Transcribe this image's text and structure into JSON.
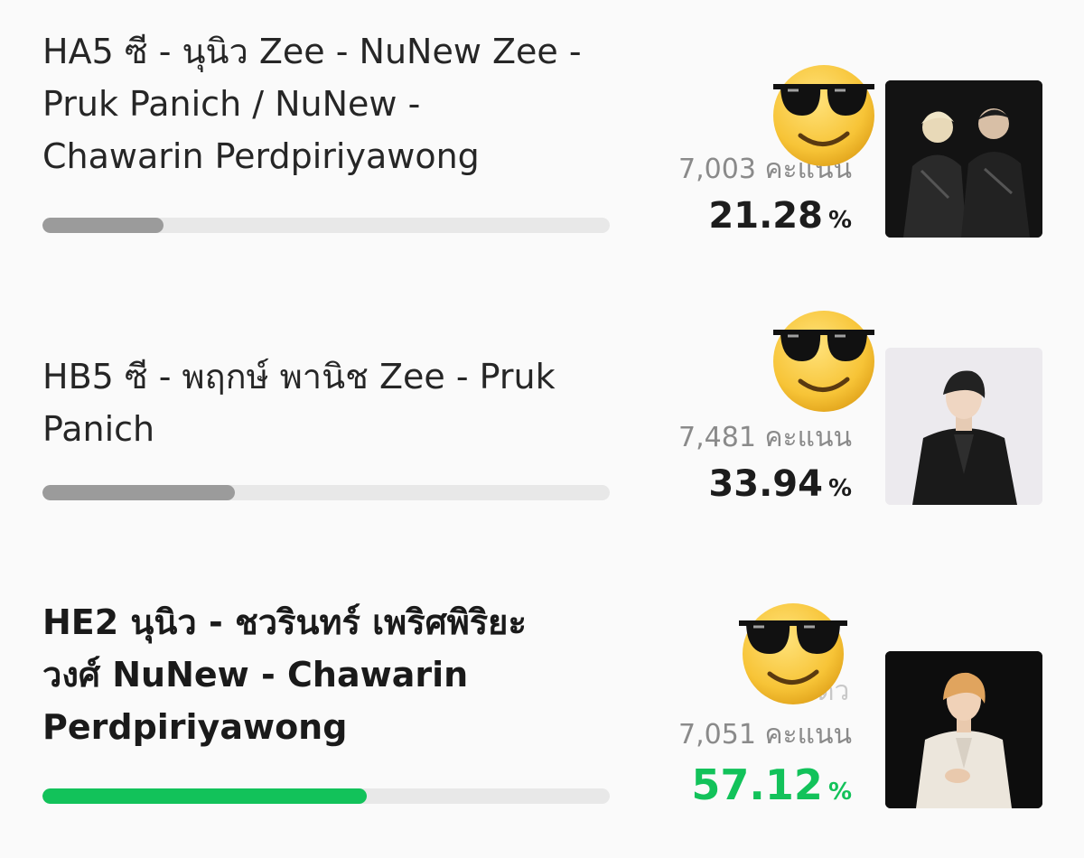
{
  "colors": {
    "leader": "#12c25a",
    "bar_default": "#9b9b9b",
    "track": "#e8e8e8"
  },
  "entries": [
    {
      "title": "HA5 ซี - นุนิว Zee - NuNew Zee - Pruk Panich / NuNew - Chawarin Perdpiriyawong",
      "title_lines": [
        "HA5 ซี - นุนิว Zee - NuNew Zee -",
        "Pruk Panich / NuNew -",
        "Chawarin Perdpiriyawong"
      ],
      "votes": "7,003 คะแนน",
      "percent": "21.28",
      "percent_sign": "%",
      "percent_value": 21.28,
      "emoji": "sunglasses-emoji",
      "photo": "duo-photo-icon",
      "leader": false
    },
    {
      "title": "HB5 ซี - พฤกษ์ พานิช Zee - Pruk Panich",
      "title_lines": [
        "HB5 ซี - พฤกษ์ พานิช Zee - Pruk",
        "Panich"
      ],
      "votes": "7,481 คะแนน",
      "percent": "33.94",
      "percent_sign": "%",
      "percent_value": 33.94,
      "emoji": "sunglasses-emoji",
      "photo": "portrait-photo-icon",
      "leader": false
    },
    {
      "title": "HE2 นุนิว - ชวรินทร์ เพริศพิริยะวงศ์ NuNew - Chawarin Perdpiriyawong",
      "title_lines": [
        "HE2 นุนิว - ชวรินทร์ เพริศพิริยะ",
        "วงศ์ NuNew - Chawarin",
        "Perdpiriyawong"
      ],
      "votes": "7,051 คะแนน",
      "percent": "57.12",
      "percent_sign": "%",
      "percent_value": 57.12,
      "partial_text": "ตัว",
      "emoji": "sunglasses-emoji",
      "photo": "portrait-photo-icon",
      "leader": true
    }
  ]
}
